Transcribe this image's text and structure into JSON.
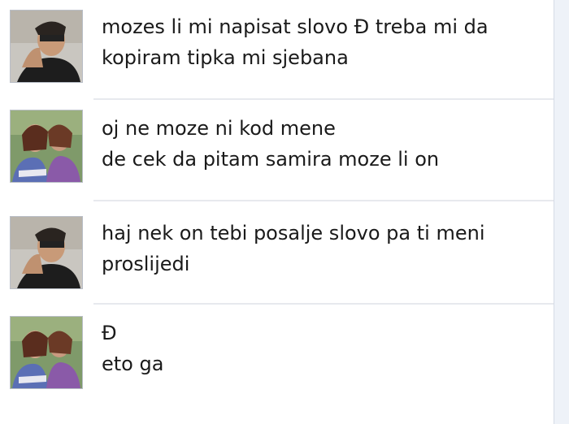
{
  "conversation": [
    {
      "sender": "user-a",
      "lines": [
        "mozes li mi napisat slovo Đ treba mi da",
        "kopiram tipka mi sjebana"
      ]
    },
    {
      "sender": "user-b",
      "lines": [
        "oj ne moze ni kod mene",
        "de cek da pitam samira moze li on"
      ]
    },
    {
      "sender": "user-a",
      "lines": [
        "haj nek on tebi posalje slovo pa ti meni",
        "proslijedi"
      ]
    },
    {
      "sender": "user-b",
      "lines": [
        "Đ",
        "eto ga"
      ]
    }
  ],
  "colors": {
    "text": "#1a1a1a",
    "separator": "#e7e9ee",
    "scroll_track": "#eef2f8"
  }
}
